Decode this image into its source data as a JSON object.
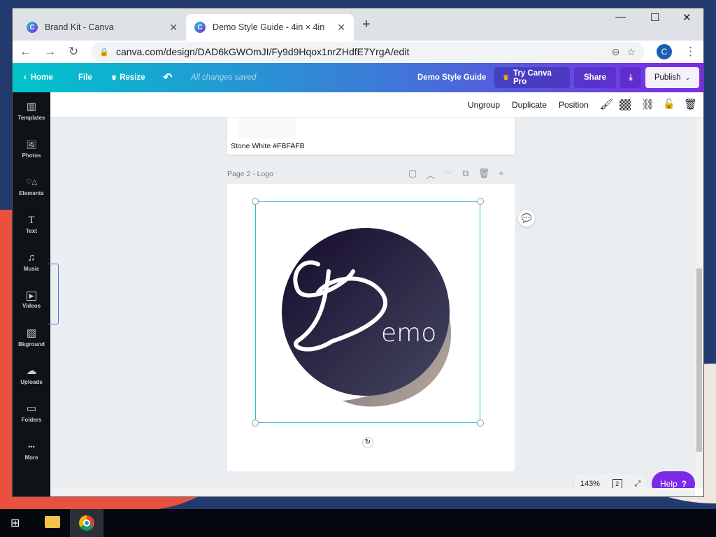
{
  "browser": {
    "tabs": [
      {
        "title": "Brand Kit - Canva",
        "active": false
      },
      {
        "title": "Demo Style Guide - 4in × 4in",
        "active": true
      }
    ],
    "url": "canva.com/design/DAD6kGWOmJI/Fy9d9Hqox1nrZHdfE7YrgA/edit",
    "profile_initial": "C"
  },
  "topbar": {
    "home": "Home",
    "file": "File",
    "resize": "Resize",
    "status": "All changes saved",
    "design_title": "Demo Style Guide",
    "try_pro": "Try Canva Pro",
    "share": "Share",
    "publish": "Publish"
  },
  "sidebar": {
    "items": [
      {
        "label": "Templates",
        "icon": "▥"
      },
      {
        "label": "Photos",
        "icon": "🖼"
      },
      {
        "label": "Elements",
        "icon": "♡△"
      },
      {
        "label": "Text",
        "icon": "T"
      },
      {
        "label": "Music",
        "icon": "♫"
      },
      {
        "label": "Videos",
        "icon": "▶"
      },
      {
        "label": "Bkground",
        "icon": "▨"
      },
      {
        "label": "Uploads",
        "icon": "☁"
      },
      {
        "label": "Folders",
        "icon": "▭"
      },
      {
        "label": "More",
        "icon": "•••"
      }
    ]
  },
  "context_toolbar": {
    "ungroup": "Ungroup",
    "duplicate": "Duplicate",
    "position": "Position"
  },
  "page1": {
    "swatch_label": "Stone White #FBFAFB"
  },
  "page2": {
    "label": "Page 2 - Logo",
    "logo_text": "emo",
    "logo_letter": "D"
  },
  "footer": {
    "zoom": "143%",
    "page_count": "2",
    "help": "Help"
  },
  "colors": {
    "accent": "#7d2ae8",
    "teal": "#00c4cc",
    "selection": "#25c2d3"
  }
}
